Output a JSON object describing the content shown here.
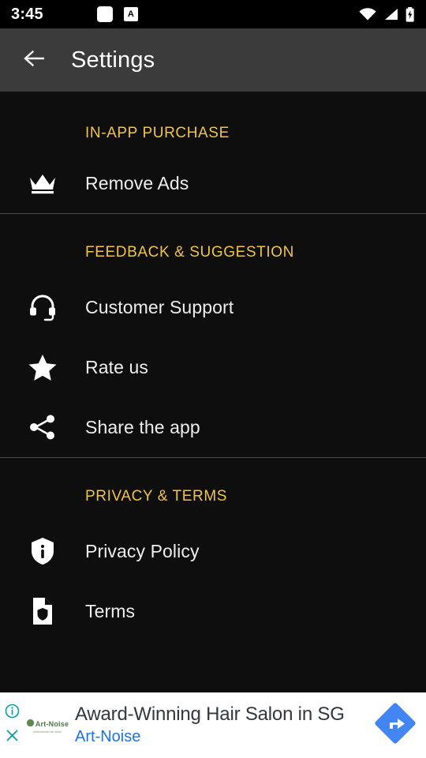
{
  "status_bar": {
    "time": "3:45",
    "notification_icons": [
      "white-square-icon",
      "letter-a-badge-icon"
    ],
    "letter_badge": "A",
    "right_icons": [
      "wifi-icon",
      "cellular-signal-icon",
      "battery-charging-icon"
    ]
  },
  "toolbar": {
    "back_icon": "back-arrow-icon",
    "title": "Settings"
  },
  "colors": {
    "section_header": "#f2c53d",
    "toolbar_bg": "#3b3b3b",
    "page_bg": "#0e0e0e",
    "label": "#eeeeee",
    "divider": "#4a4a4a",
    "ad_link": "#1a73e8",
    "ad_cta": "#4285f4"
  },
  "sections": [
    {
      "header": "IN-APP PURCHASE",
      "items": [
        {
          "label": "Remove Ads",
          "icon": "crown-icon"
        }
      ]
    },
    {
      "header": "FEEDBACK & SUGGESTION",
      "items": [
        {
          "label": "Customer Support",
          "icon": "headset-icon"
        },
        {
          "label": "Rate us",
          "icon": "star-icon"
        },
        {
          "label": "Share the app",
          "icon": "share-icon"
        }
      ]
    },
    {
      "header": "PRIVACY & TERMS",
      "items": [
        {
          "label": "Privacy Policy",
          "icon": "shield-info-icon"
        },
        {
          "label": "Terms",
          "icon": "document-shield-icon"
        }
      ]
    }
  ],
  "ad": {
    "info_icon": "ad-info-icon",
    "close_icon": "ad-close-icon",
    "logo_text": "Art-Noise",
    "logo_subtext": "professional hair salon",
    "title": "Award-Winning Hair Salon in SG",
    "advertiser": "Art-Noise",
    "cta_icon": "arrow-right-diamond-icon"
  }
}
